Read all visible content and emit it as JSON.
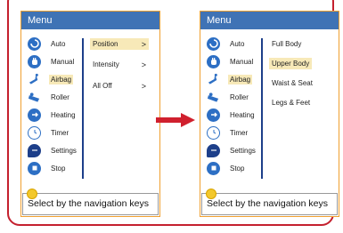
{
  "left_screen": {
    "title": "Menu",
    "menu_items": [
      {
        "label": "Auto",
        "icon": "auto-icon",
        "selected": false
      },
      {
        "label": "Manual",
        "icon": "hand-icon",
        "selected": false
      },
      {
        "label": "Airbag",
        "icon": "airbag-icon",
        "selected": true
      },
      {
        "label": "Roller",
        "icon": "roller-icon",
        "selected": false
      },
      {
        "label": "Heating",
        "icon": "heating-icon",
        "selected": false
      },
      {
        "label": "Timer",
        "icon": "timer-icon",
        "selected": false
      },
      {
        "label": "Settings",
        "icon": "settings-icon",
        "selected": false
      },
      {
        "label": "Stop",
        "icon": "stop-icon",
        "selected": false
      }
    ],
    "submenu": [
      {
        "label": "Position",
        "chevron": ">",
        "selected": true
      },
      {
        "label": "Intensity",
        "chevron": ">",
        "selected": false
      },
      {
        "label": "All Off",
        "chevron": ">",
        "selected": false
      }
    ],
    "status": "Select by the navigation keys"
  },
  "right_screen": {
    "title": "Menu",
    "menu_items": [
      {
        "label": "Auto",
        "icon": "auto-icon",
        "selected": false
      },
      {
        "label": "Manual",
        "icon": "hand-icon",
        "selected": false
      },
      {
        "label": "Airbag",
        "icon": "airbag-icon",
        "selected": true
      },
      {
        "label": "Roller",
        "icon": "roller-icon",
        "selected": false
      },
      {
        "label": "Heating",
        "icon": "heating-icon",
        "selected": false
      },
      {
        "label": "Timer",
        "icon": "timer-icon",
        "selected": false
      },
      {
        "label": "Settings",
        "icon": "settings-icon",
        "selected": false
      },
      {
        "label": "Stop",
        "icon": "stop-icon",
        "selected": false
      }
    ],
    "submenu": [
      {
        "label": "Full Body",
        "selected": false
      },
      {
        "label": "Upper Body",
        "selected": true
      },
      {
        "label": "Waist & Seat",
        "selected": false
      },
      {
        "label": "Legs & Feet",
        "selected": false
      }
    ],
    "status": "Select by the navigation keys"
  },
  "colors": {
    "frame": "#c4202e",
    "title_bar": "#3f73b5",
    "highlight": "#f7e9b8",
    "divider": "#1d3f8a",
    "arrow": "#d0202e"
  }
}
